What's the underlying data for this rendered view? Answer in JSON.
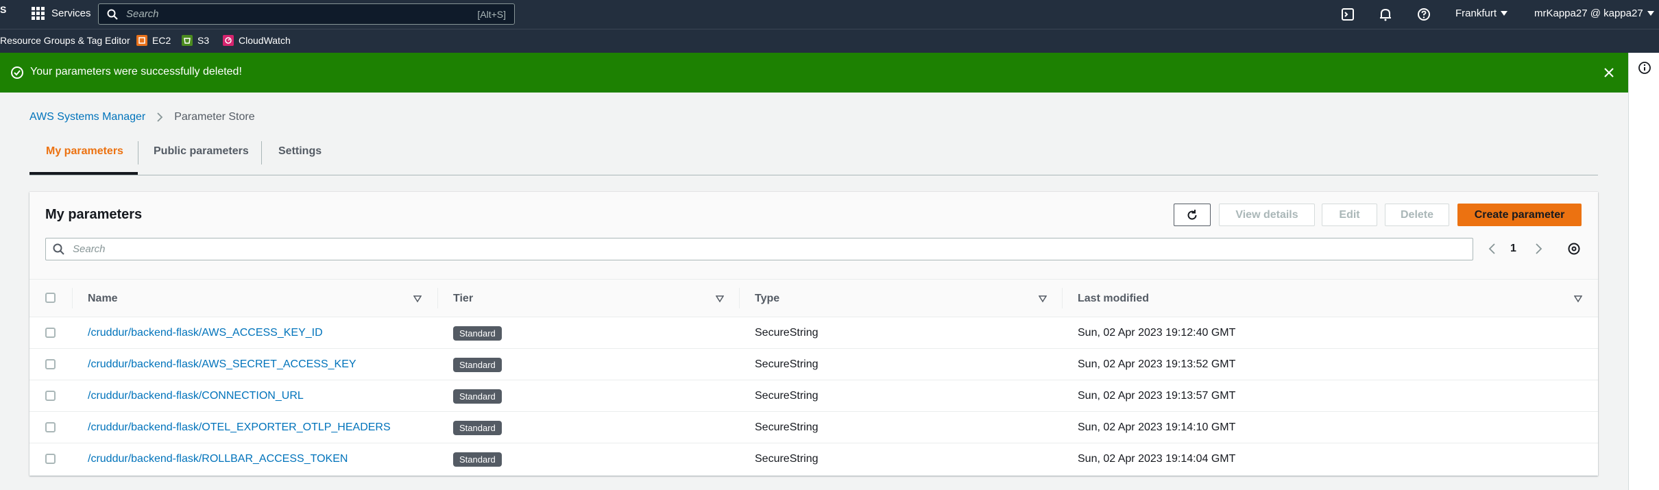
{
  "topnav": {
    "logo_fragment": "S",
    "services_label": "Services",
    "search_placeholder": "Search",
    "search_shortcut": "[Alt+S]",
    "region": "Frankfurt",
    "account": "mrKappa27 @ kappa27"
  },
  "favorites": [
    {
      "label": "Resource Groups & Tag Editor",
      "icon": "none"
    },
    {
      "label": "EC2",
      "icon": "ec2-icon",
      "color": "#e7711b"
    },
    {
      "label": "S3",
      "icon": "s3-icon",
      "color": "#4b8b1f"
    },
    {
      "label": "CloudWatch",
      "icon": "cloudwatch-icon",
      "color": "#d6246e"
    }
  ],
  "flash": {
    "message": "Your parameters were successfully deleted!",
    "color": "#1d8102"
  },
  "breadcrumb": {
    "parent": "AWS Systems Manager",
    "current": "Parameter Store"
  },
  "tabs": [
    {
      "label": "My parameters",
      "active": true
    },
    {
      "label": "Public parameters",
      "active": false
    },
    {
      "label": "Settings",
      "active": false
    }
  ],
  "panel": {
    "title": "My parameters",
    "buttons": {
      "view_details": "View details",
      "edit": "Edit",
      "delete": "Delete",
      "create": "Create parameter"
    },
    "search_placeholder": "Search",
    "page": "1"
  },
  "table": {
    "columns": [
      "Name",
      "Tier",
      "Type",
      "Last modified"
    ],
    "rows": [
      {
        "name": "/cruddur/backend-flask/AWS_ACCESS_KEY_ID",
        "tier": "Standard",
        "type": "SecureString",
        "modified": "Sun, 02 Apr 2023 19:12:40 GMT"
      },
      {
        "name": "/cruddur/backend-flask/AWS_SECRET_ACCESS_KEY",
        "tier": "Standard",
        "type": "SecureString",
        "modified": "Sun, 02 Apr 2023 19:13:52 GMT"
      },
      {
        "name": "/cruddur/backend-flask/CONNECTION_URL",
        "tier": "Standard",
        "type": "SecureString",
        "modified": "Sun, 02 Apr 2023 19:13:57 GMT"
      },
      {
        "name": "/cruddur/backend-flask/OTEL_EXPORTER_OTLP_HEADERS",
        "tier": "Standard",
        "type": "SecureString",
        "modified": "Sun, 02 Apr 2023 19:14:10 GMT"
      },
      {
        "name": "/cruddur/backend-flask/ROLLBAR_ACCESS_TOKEN",
        "tier": "Standard",
        "type": "SecureString",
        "modified": "Sun, 02 Apr 2023 19:14:04 GMT"
      }
    ]
  },
  "colors": {
    "nav_bg": "#232f3e",
    "accent": "#ec7211",
    "link": "#0073bb"
  }
}
